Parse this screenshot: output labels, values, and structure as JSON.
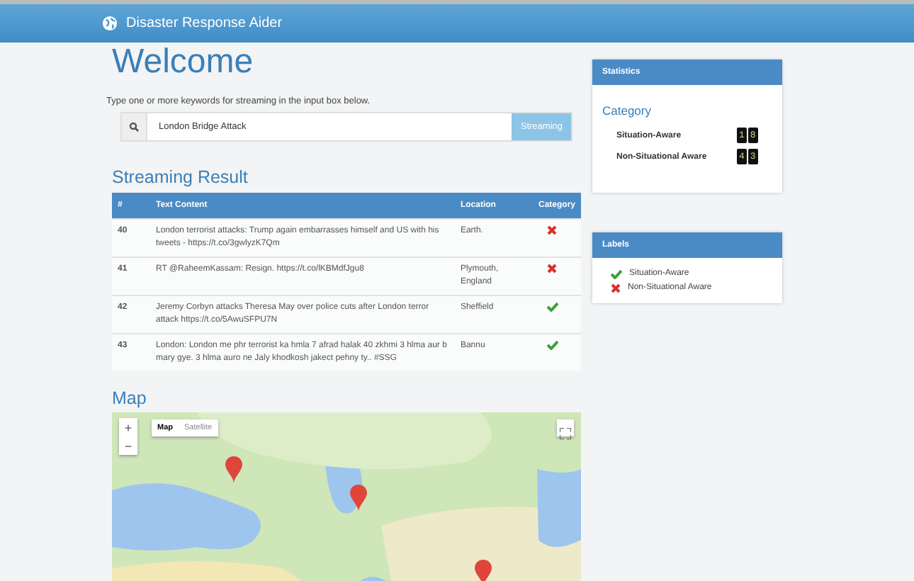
{
  "header": {
    "title": "Disaster Response Aider"
  },
  "welcome": {
    "title": "Welcome",
    "instruction": "Type one or more keywords for streaming in the input box below.",
    "search": {
      "value": "London Bridge Attack",
      "button": "Streaming"
    }
  },
  "results": {
    "title": "Streaming Result",
    "columns": [
      "#",
      "Text Content",
      "Location",
      "Category"
    ],
    "rows": [
      {
        "id": "40",
        "text": "London terrorist attacks: Trump again embarrasses himself and US with his tweets - https://t.co/3gwlyzK7Qm",
        "location": "Earth.",
        "situation_aware": false
      },
      {
        "id": "41",
        "text": "RT @RaheemKassam: Resign. https://t.co/lKBMdfJgu8",
        "location": "Plymouth, England",
        "situation_aware": false
      },
      {
        "id": "42",
        "text": "Jeremy Corbyn attacks Theresa May over police cuts after London terror attack https://t.co/5AwuSFPU7N",
        "location": "Sheffield",
        "situation_aware": true
      },
      {
        "id": "43",
        "text": "London: London me phr terrorist ka hmla 7 afrad halak 40 zkhmi 3 hlma aur b mary gye. 3 hlma auro ne Jaly khodkosh jakect pehny ty.. #SSG",
        "location": "Bannu",
        "situation_aware": true
      }
    ]
  },
  "map": {
    "title": "Map",
    "zoom_in": "+",
    "zoom_out": "−",
    "map_types": [
      {
        "label": "Map",
        "selected": true
      },
      {
        "label": "Satellite",
        "selected": false
      }
    ]
  },
  "statistics": {
    "title": "Statistics",
    "subtitle": "Category",
    "counts": [
      {
        "label": "Situation-Aware",
        "digits": [
          "1",
          "8"
        ]
      },
      {
        "label": "Non-Situational Aware",
        "digits": [
          "4",
          "3"
        ]
      }
    ]
  },
  "labels": {
    "title": "Labels",
    "items": [
      {
        "kind": "check",
        "label": "Situation-Aware"
      },
      {
        "kind": "cross",
        "label": "Non-Situational Aware"
      }
    ]
  }
}
